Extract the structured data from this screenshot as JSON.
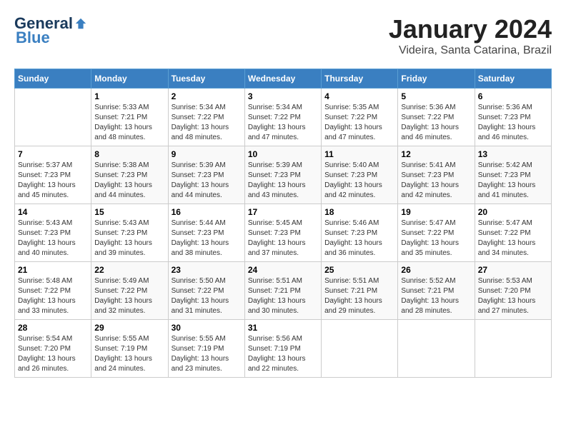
{
  "header": {
    "logo": {
      "general": "General",
      "blue": "Blue"
    },
    "title": "January 2024",
    "location": "Videira, Santa Catarina, Brazil"
  },
  "columns": [
    "Sunday",
    "Monday",
    "Tuesday",
    "Wednesday",
    "Thursday",
    "Friday",
    "Saturday"
  ],
  "weeks": [
    [
      {
        "day": "",
        "sunrise": "",
        "sunset": "",
        "daylight": ""
      },
      {
        "day": "1",
        "sunrise": "Sunrise: 5:33 AM",
        "sunset": "Sunset: 7:21 PM",
        "daylight": "Daylight: 13 hours and 48 minutes."
      },
      {
        "day": "2",
        "sunrise": "Sunrise: 5:34 AM",
        "sunset": "Sunset: 7:22 PM",
        "daylight": "Daylight: 13 hours and 48 minutes."
      },
      {
        "day": "3",
        "sunrise": "Sunrise: 5:34 AM",
        "sunset": "Sunset: 7:22 PM",
        "daylight": "Daylight: 13 hours and 47 minutes."
      },
      {
        "day": "4",
        "sunrise": "Sunrise: 5:35 AM",
        "sunset": "Sunset: 7:22 PM",
        "daylight": "Daylight: 13 hours and 47 minutes."
      },
      {
        "day": "5",
        "sunrise": "Sunrise: 5:36 AM",
        "sunset": "Sunset: 7:22 PM",
        "daylight": "Daylight: 13 hours and 46 minutes."
      },
      {
        "day": "6",
        "sunrise": "Sunrise: 5:36 AM",
        "sunset": "Sunset: 7:23 PM",
        "daylight": "Daylight: 13 hours and 46 minutes."
      }
    ],
    [
      {
        "day": "7",
        "sunrise": "Sunrise: 5:37 AM",
        "sunset": "Sunset: 7:23 PM",
        "daylight": "Daylight: 13 hours and 45 minutes."
      },
      {
        "day": "8",
        "sunrise": "Sunrise: 5:38 AM",
        "sunset": "Sunset: 7:23 PM",
        "daylight": "Daylight: 13 hours and 44 minutes."
      },
      {
        "day": "9",
        "sunrise": "Sunrise: 5:39 AM",
        "sunset": "Sunset: 7:23 PM",
        "daylight": "Daylight: 13 hours and 44 minutes."
      },
      {
        "day": "10",
        "sunrise": "Sunrise: 5:39 AM",
        "sunset": "Sunset: 7:23 PM",
        "daylight": "Daylight: 13 hours and 43 minutes."
      },
      {
        "day": "11",
        "sunrise": "Sunrise: 5:40 AM",
        "sunset": "Sunset: 7:23 PM",
        "daylight": "Daylight: 13 hours and 42 minutes."
      },
      {
        "day": "12",
        "sunrise": "Sunrise: 5:41 AM",
        "sunset": "Sunset: 7:23 PM",
        "daylight": "Daylight: 13 hours and 42 minutes."
      },
      {
        "day": "13",
        "sunrise": "Sunrise: 5:42 AM",
        "sunset": "Sunset: 7:23 PM",
        "daylight": "Daylight: 13 hours and 41 minutes."
      }
    ],
    [
      {
        "day": "14",
        "sunrise": "Sunrise: 5:43 AM",
        "sunset": "Sunset: 7:23 PM",
        "daylight": "Daylight: 13 hours and 40 minutes."
      },
      {
        "day": "15",
        "sunrise": "Sunrise: 5:43 AM",
        "sunset": "Sunset: 7:23 PM",
        "daylight": "Daylight: 13 hours and 39 minutes."
      },
      {
        "day": "16",
        "sunrise": "Sunrise: 5:44 AM",
        "sunset": "Sunset: 7:23 PM",
        "daylight": "Daylight: 13 hours and 38 minutes."
      },
      {
        "day": "17",
        "sunrise": "Sunrise: 5:45 AM",
        "sunset": "Sunset: 7:23 PM",
        "daylight": "Daylight: 13 hours and 37 minutes."
      },
      {
        "day": "18",
        "sunrise": "Sunrise: 5:46 AM",
        "sunset": "Sunset: 7:23 PM",
        "daylight": "Daylight: 13 hours and 36 minutes."
      },
      {
        "day": "19",
        "sunrise": "Sunrise: 5:47 AM",
        "sunset": "Sunset: 7:22 PM",
        "daylight": "Daylight: 13 hours and 35 minutes."
      },
      {
        "day": "20",
        "sunrise": "Sunrise: 5:47 AM",
        "sunset": "Sunset: 7:22 PM",
        "daylight": "Daylight: 13 hours and 34 minutes."
      }
    ],
    [
      {
        "day": "21",
        "sunrise": "Sunrise: 5:48 AM",
        "sunset": "Sunset: 7:22 PM",
        "daylight": "Daylight: 13 hours and 33 minutes."
      },
      {
        "day": "22",
        "sunrise": "Sunrise: 5:49 AM",
        "sunset": "Sunset: 7:22 PM",
        "daylight": "Daylight: 13 hours and 32 minutes."
      },
      {
        "day": "23",
        "sunrise": "Sunrise: 5:50 AM",
        "sunset": "Sunset: 7:22 PM",
        "daylight": "Daylight: 13 hours and 31 minutes."
      },
      {
        "day": "24",
        "sunrise": "Sunrise: 5:51 AM",
        "sunset": "Sunset: 7:21 PM",
        "daylight": "Daylight: 13 hours and 30 minutes."
      },
      {
        "day": "25",
        "sunrise": "Sunrise: 5:51 AM",
        "sunset": "Sunset: 7:21 PM",
        "daylight": "Daylight: 13 hours and 29 minutes."
      },
      {
        "day": "26",
        "sunrise": "Sunrise: 5:52 AM",
        "sunset": "Sunset: 7:21 PM",
        "daylight": "Daylight: 13 hours and 28 minutes."
      },
      {
        "day": "27",
        "sunrise": "Sunrise: 5:53 AM",
        "sunset": "Sunset: 7:20 PM",
        "daylight": "Daylight: 13 hours and 27 minutes."
      }
    ],
    [
      {
        "day": "28",
        "sunrise": "Sunrise: 5:54 AM",
        "sunset": "Sunset: 7:20 PM",
        "daylight": "Daylight: 13 hours and 26 minutes."
      },
      {
        "day": "29",
        "sunrise": "Sunrise: 5:55 AM",
        "sunset": "Sunset: 7:19 PM",
        "daylight": "Daylight: 13 hours and 24 minutes."
      },
      {
        "day": "30",
        "sunrise": "Sunrise: 5:55 AM",
        "sunset": "Sunset: 7:19 PM",
        "daylight": "Daylight: 13 hours and 23 minutes."
      },
      {
        "day": "31",
        "sunrise": "Sunrise: 5:56 AM",
        "sunset": "Sunset: 7:19 PM",
        "daylight": "Daylight: 13 hours and 22 minutes."
      },
      {
        "day": "",
        "sunrise": "",
        "sunset": "",
        "daylight": ""
      },
      {
        "day": "",
        "sunrise": "",
        "sunset": "",
        "daylight": ""
      },
      {
        "day": "",
        "sunrise": "",
        "sunset": "",
        "daylight": ""
      }
    ]
  ]
}
